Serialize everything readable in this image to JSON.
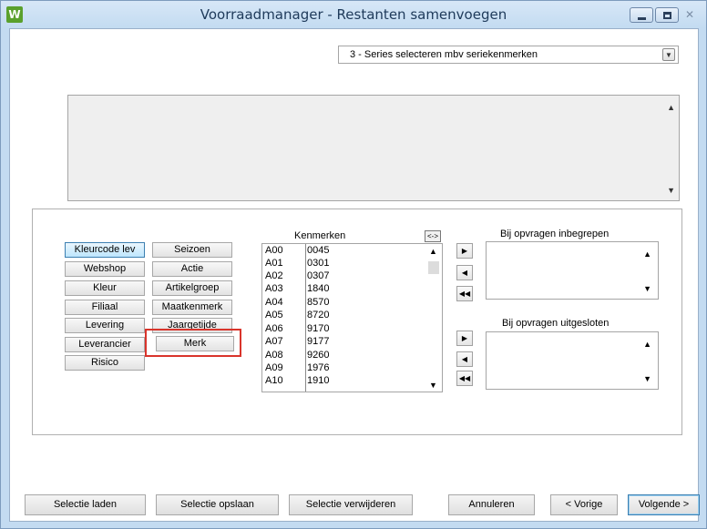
{
  "window": {
    "title": "Voorraadmanager - Restanten samenvoegen",
    "app_icon_letter": "W"
  },
  "series_select": {
    "value": "3 - Series selecteren mbv seriekenmerken"
  },
  "attribute_buttons": {
    "kleurcode_lev": "Kleurcode lev",
    "webshop": "Webshop",
    "kleur": "Kleur",
    "filiaal": "Filiaal",
    "levering": "Levering",
    "leverancier": "Leverancier",
    "risico": "Risico",
    "seizoen": "Seizoen",
    "actie": "Actie",
    "artikelgroep": "Artikelgroep",
    "maatkenmerk": "Maatkenmerk",
    "jaargetijde": "Jaargetijde",
    "merk": "Merk"
  },
  "kenmerken": {
    "title": "Kenmerken",
    "swap_label": "<->",
    "rows": [
      {
        "code": "A00",
        "value": "0045"
      },
      {
        "code": "A01",
        "value": "0301"
      },
      {
        "code": "A02",
        "value": "0307"
      },
      {
        "code": "A03",
        "value": "1840"
      },
      {
        "code": "A04",
        "value": "8570"
      },
      {
        "code": "A05",
        "value": "8720"
      },
      {
        "code": "A06",
        "value": "9170"
      },
      {
        "code": "A07",
        "value": "9177"
      },
      {
        "code": "A08",
        "value": "9260"
      },
      {
        "code": "A09",
        "value": "1976"
      },
      {
        "code": "A10",
        "value": "1910"
      }
    ]
  },
  "included": {
    "title": "Bij opvragen inbegrepen"
  },
  "excluded": {
    "title": "Bij opvragen uitgesloten"
  },
  "footer": {
    "load": "Selectie laden",
    "save": "Selectie opslaan",
    "delete": "Selectie verwijderen",
    "cancel": "Annuleren",
    "previous": "< Vorige",
    "next": "Volgende >"
  }
}
